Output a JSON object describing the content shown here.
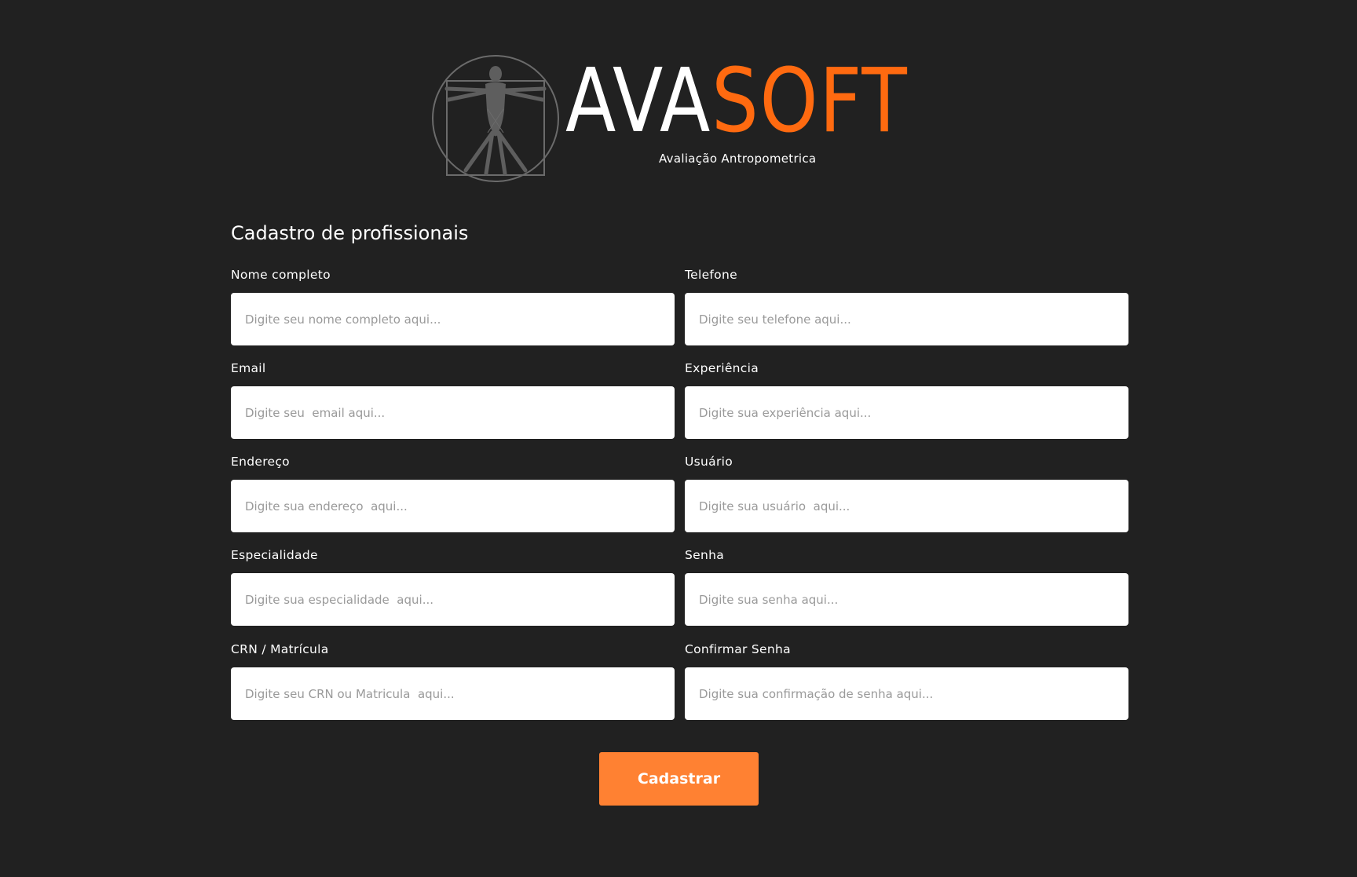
{
  "brand": {
    "name_part1": "AVA",
    "name_part2": "SOFT",
    "tagline": "Avaliação Antropometrica",
    "emblem_icon": "vitruvian-man-icon",
    "colors": {
      "accent": "#ff6a10",
      "emblem": "#6b6b6b"
    }
  },
  "form": {
    "title": "Cadastro de profissionais",
    "fields": {
      "nome": {
        "label": "Nome completo",
        "placeholder": "Digite seu nome completo aqui..."
      },
      "telefone": {
        "label": "Telefone",
        "placeholder": "Digite seu telefone aqui..."
      },
      "email": {
        "label": "Email",
        "placeholder": "Digite seu  email aqui..."
      },
      "experiencia": {
        "label": "Experiência",
        "placeholder": "Digite sua experiência aqui..."
      },
      "endereco": {
        "label": "Endereço",
        "placeholder": "Digite sua endereço  aqui..."
      },
      "usuario": {
        "label": "Usuário",
        "placeholder": "Digite sua usuário  aqui..."
      },
      "especialidade": {
        "label": "Especialidade",
        "placeholder": "Digite sua especialidade  aqui..."
      },
      "senha": {
        "label": "Senha",
        "placeholder": "Digite sua senha aqui..."
      },
      "crn": {
        "label": "CRN / Matrícula",
        "placeholder": "Digite seu CRN ou Matricula  aqui..."
      },
      "confirmar_senha": {
        "label": "Confirmar Senha",
        "placeholder": "Digite sua confirmação de senha aqui..."
      }
    },
    "submit_label": "Cadastrar"
  },
  "theme": {
    "background": "#212121",
    "button_color": "#ff8132",
    "input_background": "#ffffff",
    "placeholder_color": "#9a9a9a"
  }
}
